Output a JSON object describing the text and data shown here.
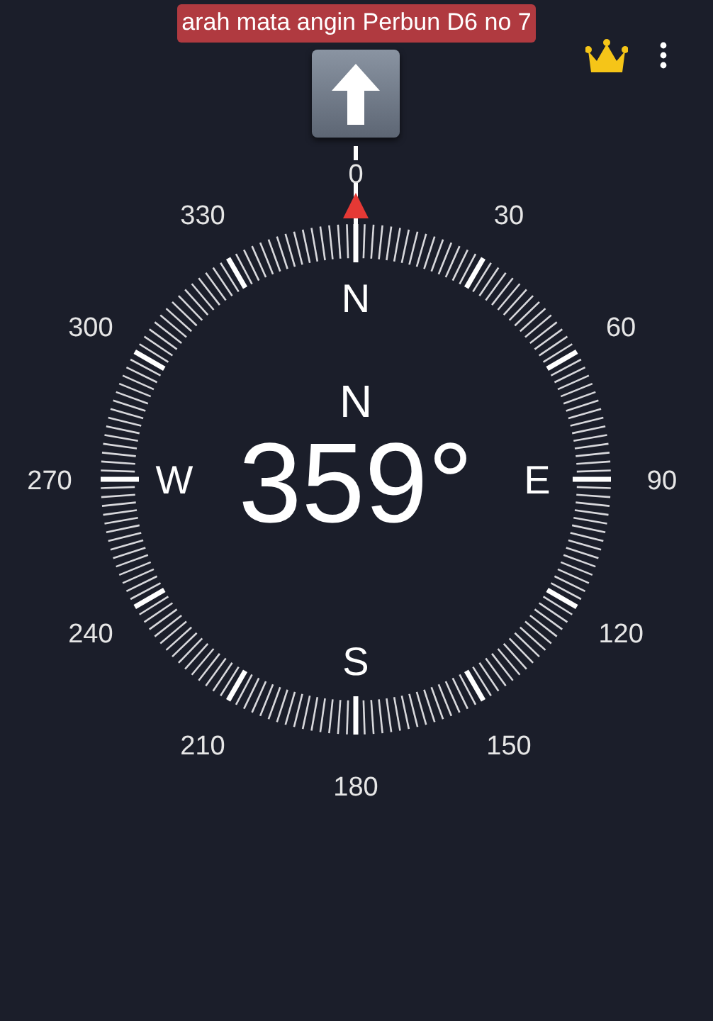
{
  "caption": "arah mata angin Perbun D6 no 7",
  "heading": {
    "direction": "N",
    "degrees": "359°"
  },
  "cardinals": [
    {
      "label": "N"
    },
    {
      "label": "E"
    },
    {
      "label": "S"
    },
    {
      "label": "W"
    }
  ],
  "dial_labels": [
    "0",
    "30",
    "60",
    "90",
    "120",
    "150",
    "180",
    "210",
    "240",
    "270",
    "300",
    "330"
  ]
}
